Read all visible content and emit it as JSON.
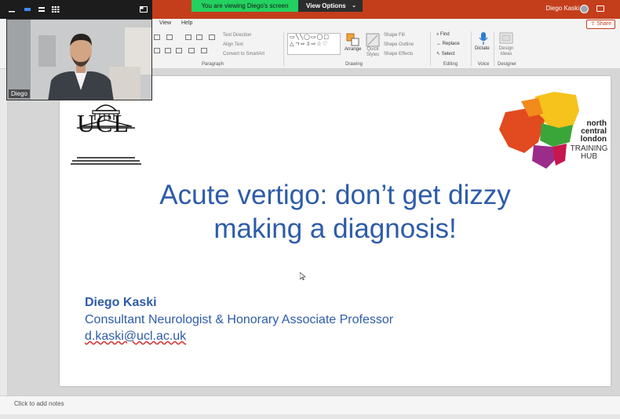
{
  "zoom": {
    "banner_text": "You are viewing Diego's screen",
    "view_options_label": "View Options",
    "participant_name": "Diego"
  },
  "app": {
    "user_name": "Diego Kaski",
    "share_label": "Share",
    "tabs": [
      "View",
      "Help"
    ]
  },
  "ribbon": {
    "paragraph": {
      "label": "Paragraph",
      "text_direction": "Text Direction",
      "align_text": "Align Text",
      "convert_smartart": "Convert to SmartArt"
    },
    "drawing": {
      "label": "Drawing",
      "arrange": "Arrange",
      "quick_styles": "Quick Styles",
      "shape_fill": "Shape Fill",
      "shape_outline": "Shape Outline",
      "shape_effects": "Shape Effects"
    },
    "editing": {
      "label": "Editing",
      "find": "Find",
      "replace": "Replace",
      "select": "Select"
    },
    "voice": {
      "label": "Voice",
      "dictate": "Dictate"
    },
    "designer": {
      "label": "Designer",
      "design_ideas": "Design Ideas"
    }
  },
  "slide": {
    "title_line1": "Acute vertigo: don’t get dizzy",
    "title_line2": "making a diagnosis!",
    "presenter_name": "Diego Kaski",
    "presenter_role": "Consultant Neurologist & Honorary Associate Professor",
    "presenter_email": "d.kaski@ucl.ac.uk",
    "ucl_logo_text": "UCL",
    "ncl_logo_line1": "north",
    "ncl_logo_line2": "central",
    "ncl_logo_line3": "london",
    "ncl_logo_line4": "TRAINING",
    "ncl_logo_line5": "HUB"
  },
  "notes": {
    "placeholder": "Click to add notes"
  },
  "colors": {
    "accent": "#c43e1c",
    "slide_text": "#2e5ca8",
    "zoom_banner": "#23d160"
  }
}
